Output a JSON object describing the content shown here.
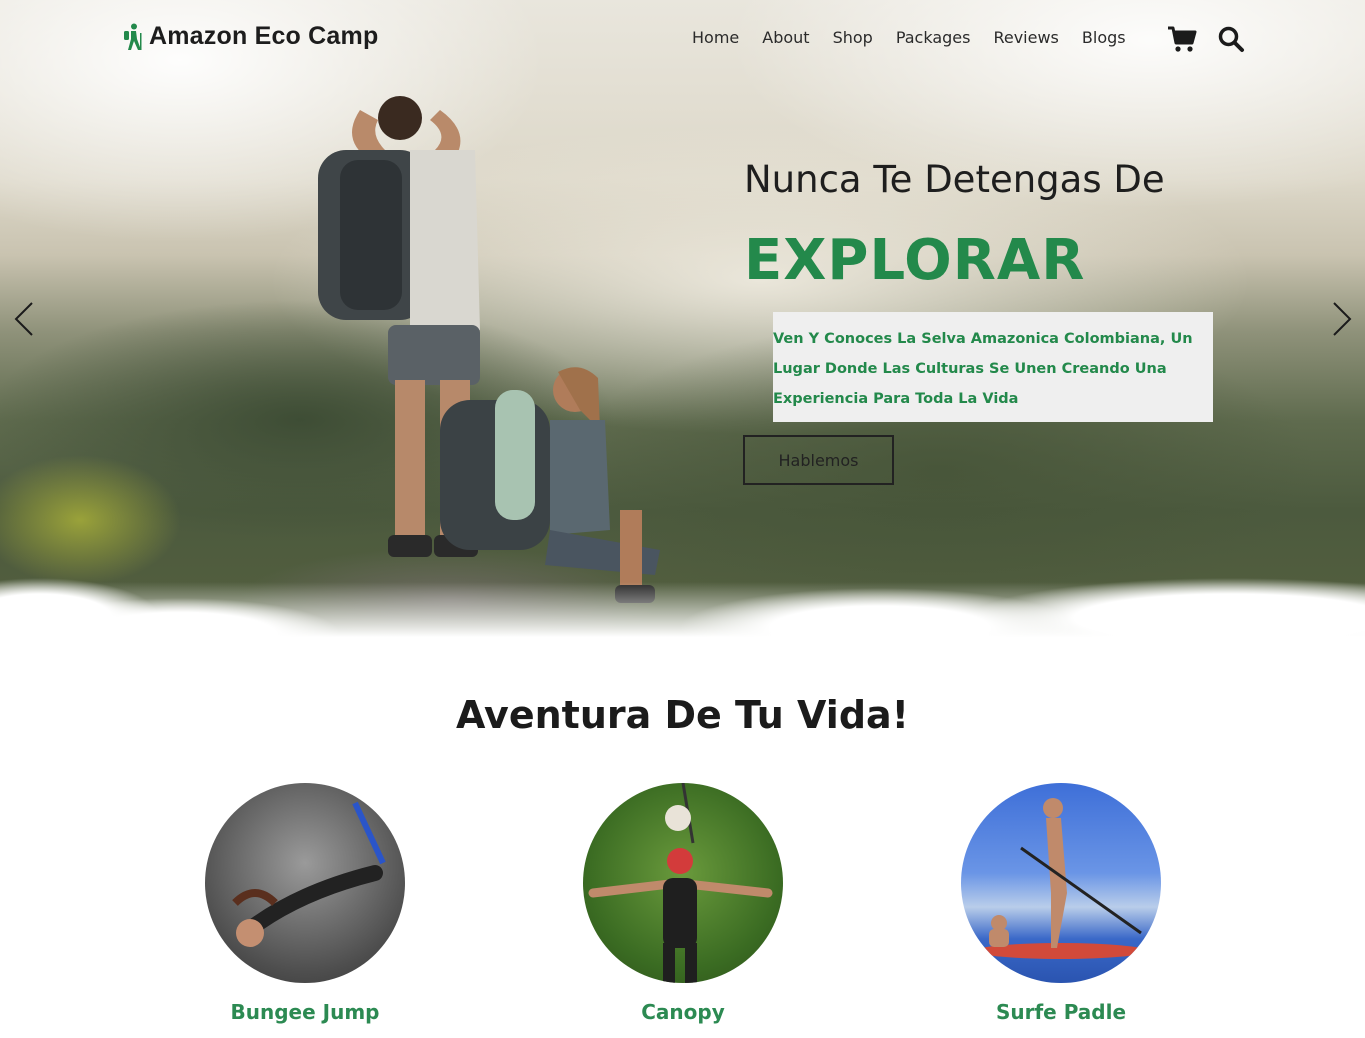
{
  "brand": {
    "name": "Amazon Eco Camp",
    "icon": "hiker-icon",
    "accent": "#23894b"
  },
  "nav": {
    "items": [
      {
        "label": "Home"
      },
      {
        "label": "About"
      },
      {
        "label": "Shop"
      },
      {
        "label": "Packages"
      },
      {
        "label": "Reviews"
      },
      {
        "label": "Blogs"
      }
    ],
    "cart_icon": "shopping-cart-icon",
    "search_icon": "search-icon"
  },
  "hero": {
    "subtitle": "Nunca Te Detengas De",
    "title": "EXPLORAR",
    "description": "Ven Y Conoces La Selva Amazonica Colombiana, Un Lugar Donde Las Culturas Se Unen Creando Una Experiencia Para Toda La Vida",
    "cta_label": "Hablemos",
    "prev_icon": "chevron-left-icon",
    "next_icon": "chevron-right-icon"
  },
  "adventures": {
    "title": "Aventura De Tu Vida!",
    "items": [
      {
        "label": "Bungee Jump"
      },
      {
        "label": "Canopy"
      },
      {
        "label": "Surfe Padle"
      }
    ]
  }
}
